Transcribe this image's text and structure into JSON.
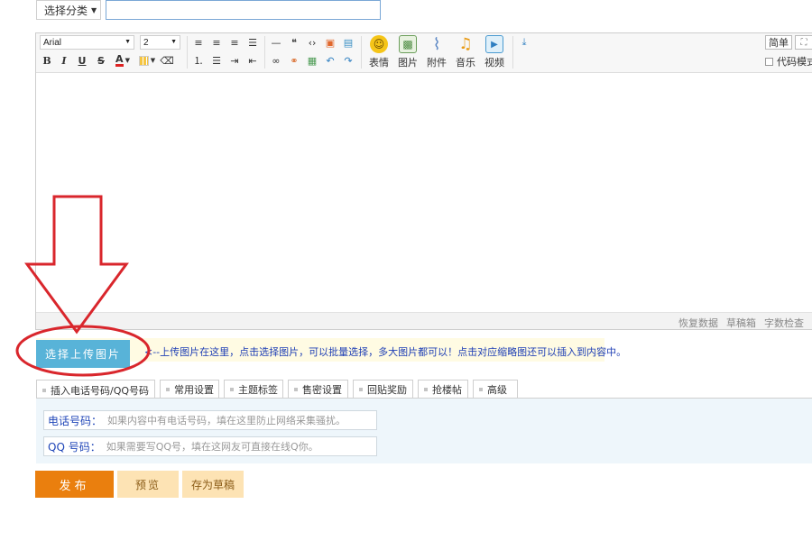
{
  "category": {
    "label": "选择分类"
  },
  "title_input": {
    "value": "",
    "placeholder": ""
  },
  "toolbar": {
    "font_family": "Arial",
    "font_size": "2",
    "bold": "B",
    "italic": "I",
    "underline": "U",
    "strike": "S",
    "font_color": "A",
    "big_buttons": [
      {
        "label": "表情",
        "icon": "smiley-icon",
        "color": "#f5c518"
      },
      {
        "label": "图片",
        "icon": "image-icon",
        "color": "#5aa36a"
      },
      {
        "label": "附件",
        "icon": "paperclip-icon",
        "color": "#6a8fc8"
      },
      {
        "label": "音乐",
        "icon": "music-icon",
        "color": "#f0a020"
      },
      {
        "label": "视频",
        "icon": "video-icon",
        "color": "#4a9ad0"
      }
    ],
    "simple": "简单",
    "code_mode": "代码模式"
  },
  "status_bar": {
    "restore": "恢复数据",
    "drafts": "草稿箱",
    "word_check": "字数检查"
  },
  "upload": {
    "button": "选择上传图片",
    "tip": "<--上传图片在这里，点击选择图片，可以批量选择，多大图片都可以！点击对应缩略图还可以插入到内容中。"
  },
  "tabs": [
    {
      "label": "插入电话号码/QQ号码",
      "active": true
    },
    {
      "label": "常用设置"
    },
    {
      "label": "主题标签"
    },
    {
      "label": "售密设置"
    },
    {
      "label": "回贴奖励"
    },
    {
      "label": "抢楼帖"
    },
    {
      "label": "高级"
    }
  ],
  "fields": {
    "phone_label": "电话号码：",
    "phone_placeholder": "如果内容中有电话号码，填在这里防止网络采集骚扰。",
    "qq_label": "QQ 号码：",
    "qq_placeholder": "如果需要写QQ号，填在这网友可直接在线Q你。"
  },
  "actions": {
    "publish": "发布",
    "preview": "预览",
    "save_draft": "存为草稿"
  },
  "colors": {
    "upload_button": "#58b3d8",
    "publish_button": "#ea7f0e",
    "annotation": "#d9262c"
  }
}
